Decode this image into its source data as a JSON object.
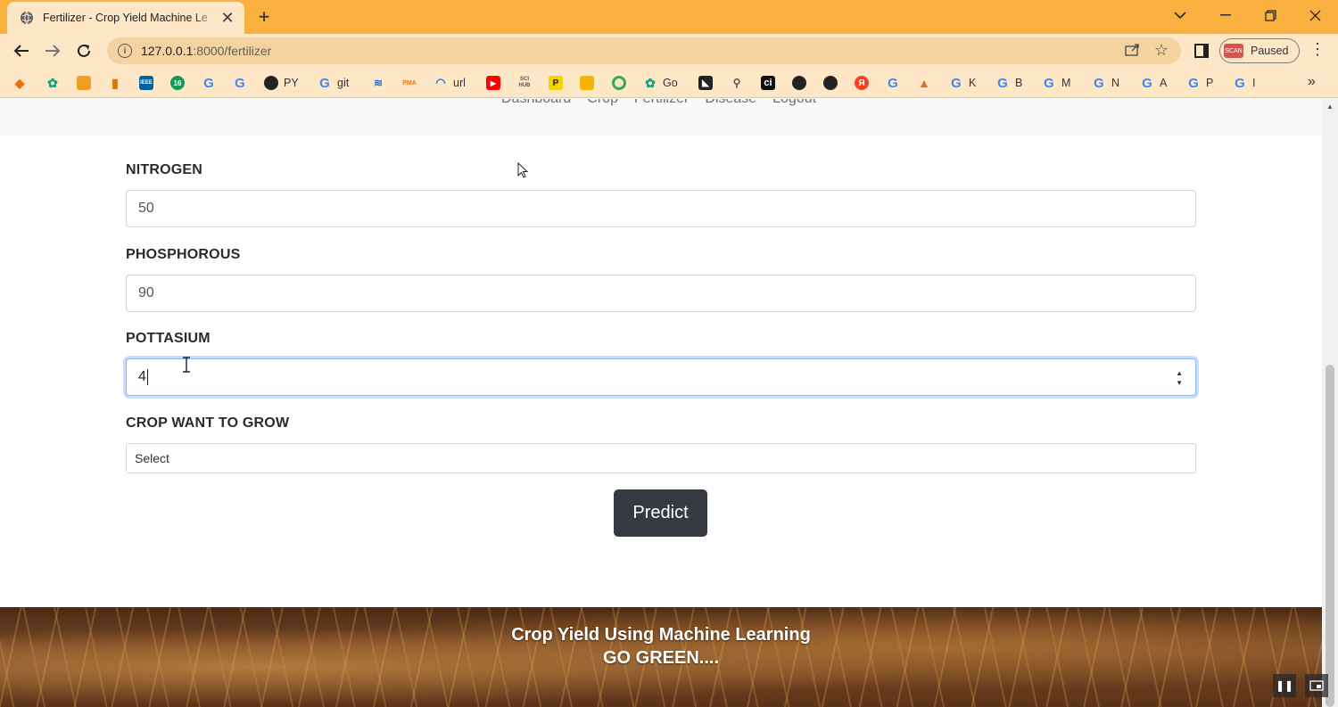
{
  "browser": {
    "tab_title": "Fertilizer - Crop Yield Machine Le",
    "tab_close": "✕",
    "new_tab": "+",
    "url_host": "127.0.0.1",
    "url_path": ":8000/fertilizer",
    "profile_label": "Paused",
    "avatar_text": "SCAN",
    "bookmarks": [
      {
        "icon": "py",
        "label": "PY"
      },
      {
        "icon": "google",
        "label": "git"
      },
      {
        "icon": "url",
        "label": "url"
      },
      {
        "icon": "sci",
        "label": "SCI HUB"
      },
      {
        "icon": "go",
        "label": "Go"
      },
      {
        "icon": "google",
        "label": "K"
      },
      {
        "icon": "google",
        "label": "B"
      },
      {
        "icon": "google",
        "label": "M"
      },
      {
        "icon": "google",
        "label": "N"
      },
      {
        "icon": "google",
        "label": "A"
      },
      {
        "icon": "google",
        "label": "P"
      },
      {
        "icon": "google",
        "label": "I"
      }
    ],
    "bookmark_badge_16": "16",
    "bookmark_ieee": "IEEE",
    "bookmark_pma": "PMA",
    "bookmark_p": "P",
    "bookmark_ci": "ci",
    "bookmark_ya": "Я"
  },
  "nav": {
    "links": [
      "Dashboard",
      "Crop",
      "Fertilizer",
      "Disease",
      "Logout"
    ]
  },
  "form": {
    "nitrogen_label": "NITROGEN",
    "nitrogen_value": "50",
    "phosphorous_label": "PHOSPHOROUS",
    "phosphorous_value": "90",
    "pottasium_label": "POTTASIUM",
    "pottasium_value": "4",
    "crop_label": "CROP WANT TO GROW",
    "crop_selected": "Select",
    "predict_label": "Predict"
  },
  "footer": {
    "title": "Crop Yield Using Machine Learning",
    "subtitle": "GO GREEN...."
  },
  "colors": {
    "chrome_orange": "#f9b03f",
    "toolbar_bg": "#fde7c7",
    "button_dark": "#343a40",
    "focus_ring": "#86b7fe"
  }
}
